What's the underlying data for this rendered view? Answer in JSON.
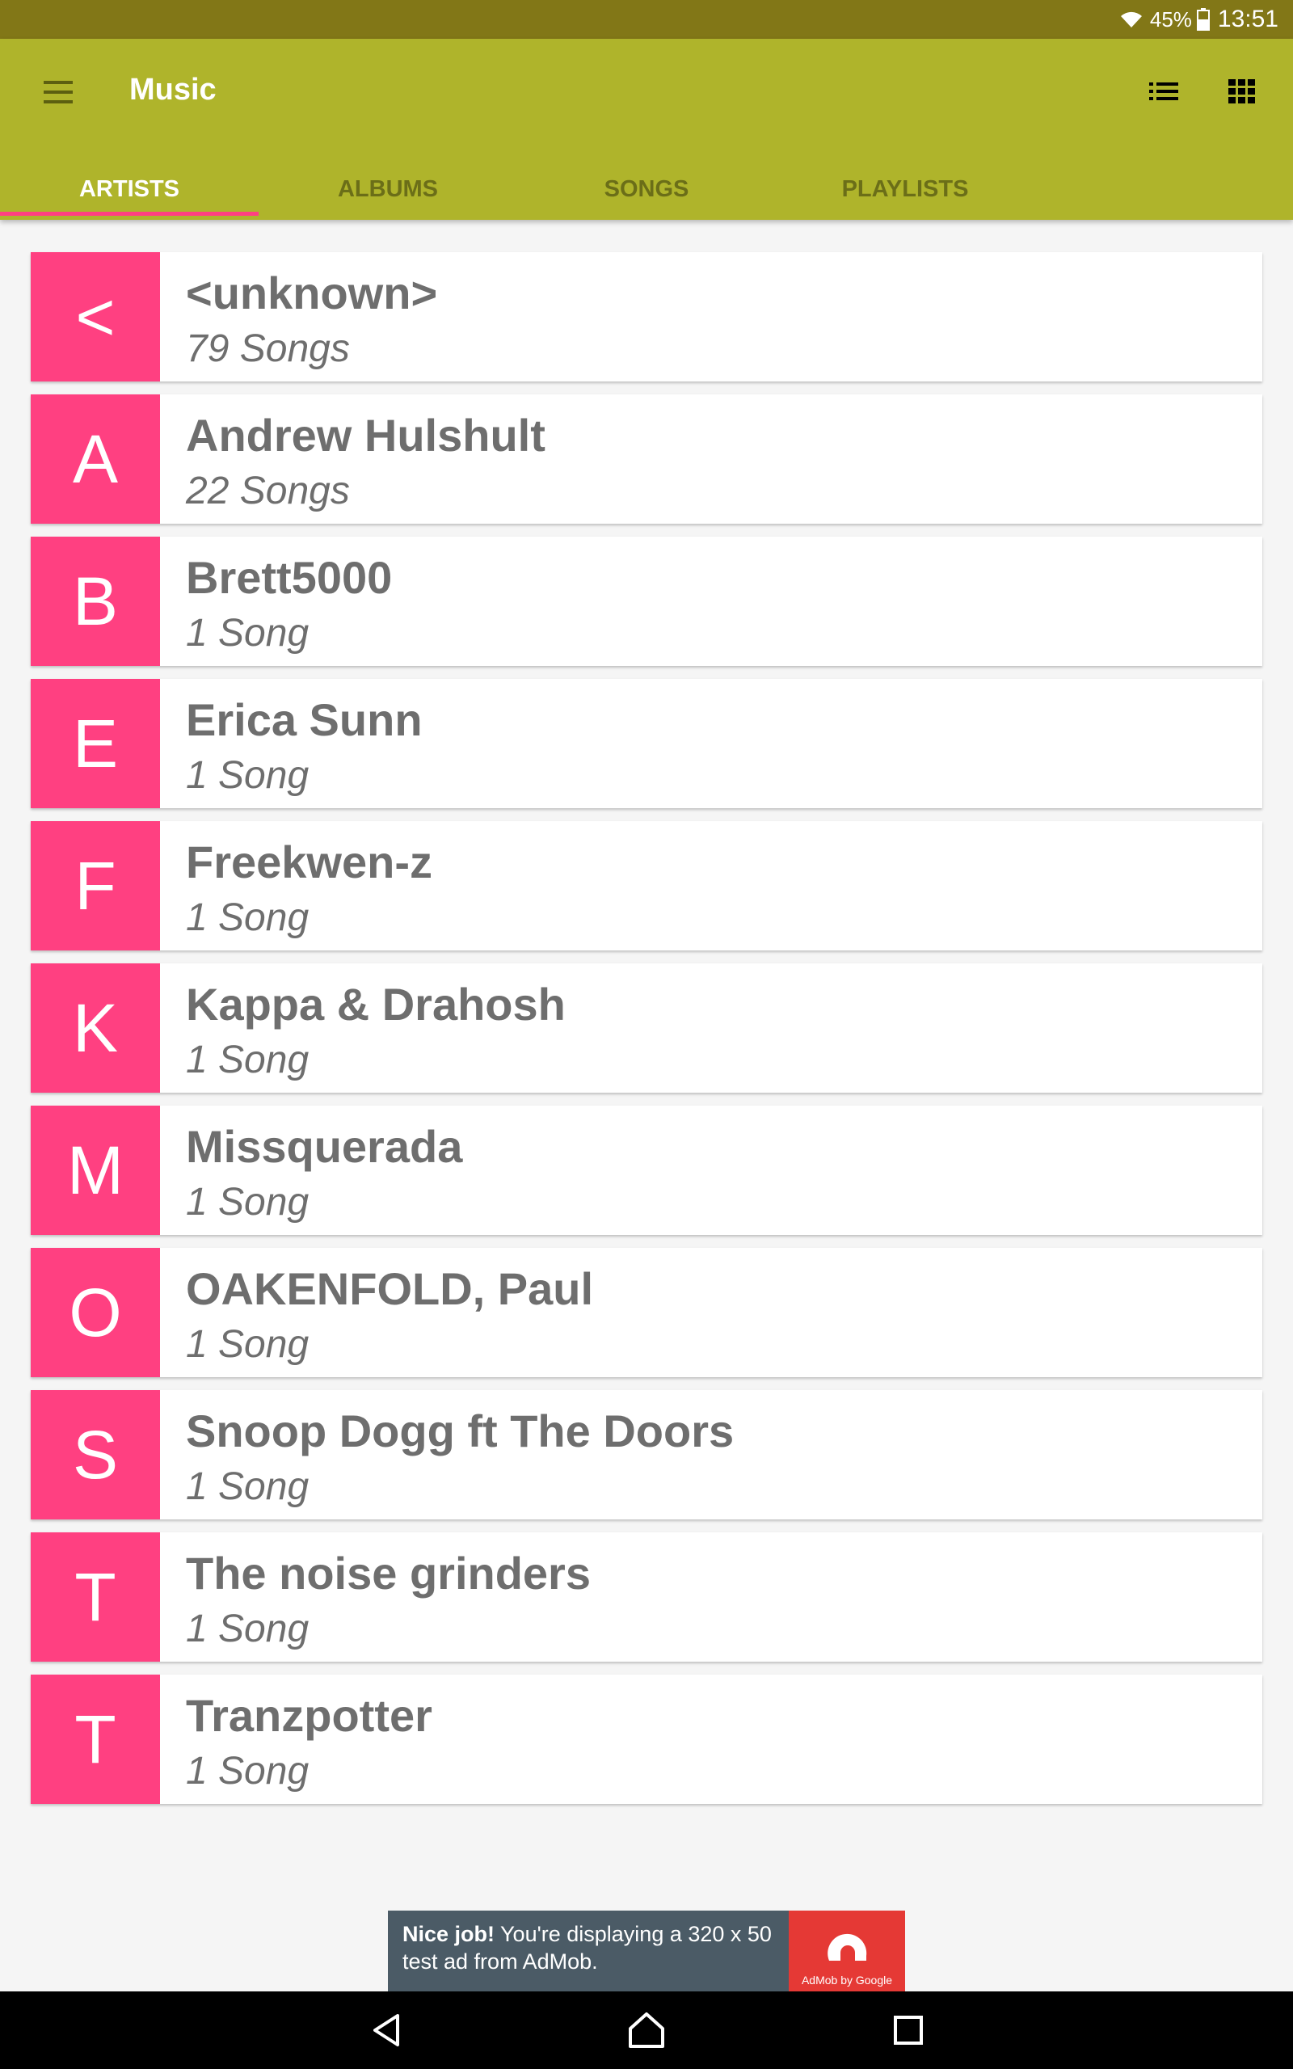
{
  "status_bar": {
    "battery": "45%",
    "time": "13:51"
  },
  "app_bar": {
    "title": "Music",
    "tabs": [
      {
        "label": "ARTISTS",
        "active": true
      },
      {
        "label": "ALBUMS",
        "active": false
      },
      {
        "label": "SONGS",
        "active": false
      },
      {
        "label": "PLAYLISTS",
        "active": false
      }
    ]
  },
  "artists": [
    {
      "letter": "<",
      "name": "<unknown>",
      "count": "79 Songs"
    },
    {
      "letter": "A",
      "name": "Andrew Hulshult",
      "count": "22 Songs"
    },
    {
      "letter": "B",
      "name": "Brett5000",
      "count": "1 Song"
    },
    {
      "letter": "E",
      "name": "Erica Sunn",
      "count": "1 Song"
    },
    {
      "letter": "F",
      "name": "Freekwen-z",
      "count": "1 Song"
    },
    {
      "letter": "K",
      "name": "Kappa & Drahosh",
      "count": "1 Song"
    },
    {
      "letter": "M",
      "name": "Missquerada",
      "count": "1 Song"
    },
    {
      "letter": "O",
      "name": "OAKENFOLD, Paul",
      "count": "1 Song"
    },
    {
      "letter": "S",
      "name": "Snoop Dogg ft The Doors",
      "count": "1 Song"
    },
    {
      "letter": "T",
      "name": "The noise grinders",
      "count": "1 Song"
    },
    {
      "letter": "T",
      "name": "Tranzpotter",
      "count": "1 Song"
    }
  ],
  "ad": {
    "bold": "Nice job!",
    "text": " You're displaying a 320 x 50 test ad from AdMob.",
    "logo_caption": "AdMob by Google"
  },
  "colors": {
    "app_bar": "#afb42b",
    "status_bar": "#827717",
    "accent": "#ff4081"
  }
}
